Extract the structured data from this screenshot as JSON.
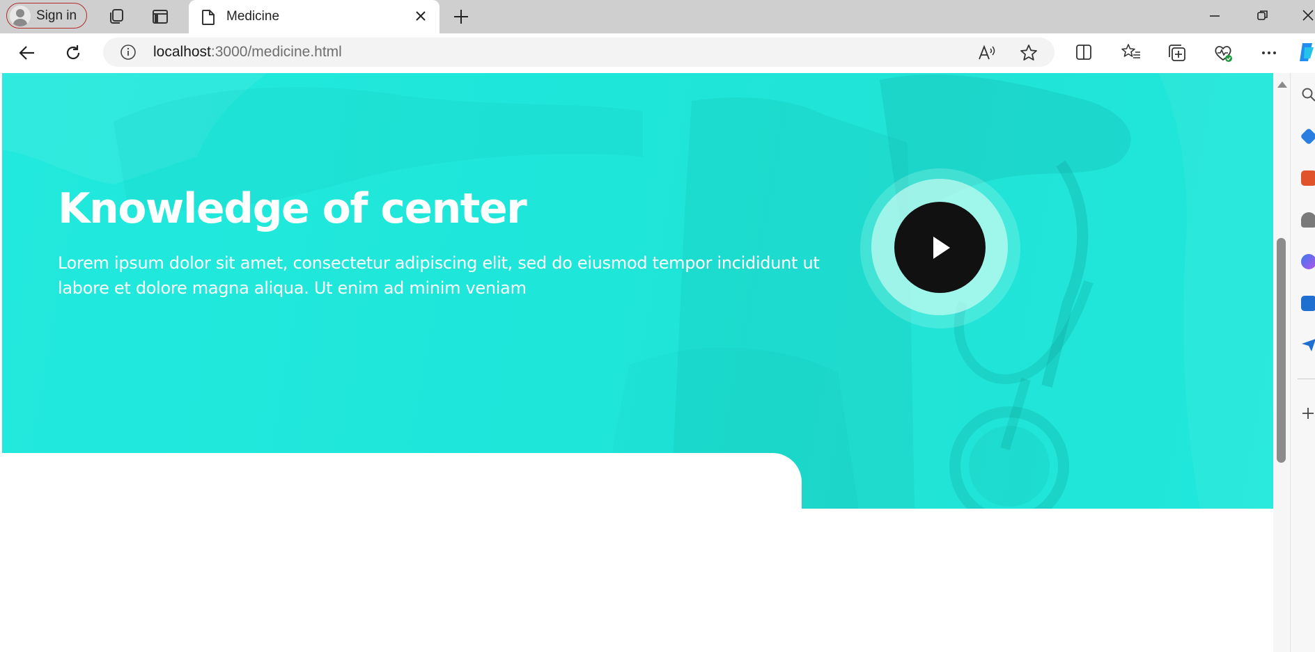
{
  "browser": {
    "signin_label": "Sign in",
    "tab": {
      "title": "Medicine"
    },
    "address": {
      "host": "localhost",
      "path": ":3000/medicine.html"
    }
  },
  "hero": {
    "title": "Knowledge of center",
    "text": "Lorem ipsum dolor sit amet, consectetur adipiscing elit, sed do eiusmod tempor incididunt ut labore et dolore magna aliqua. Ut enim ad minim veniam"
  },
  "colors": {
    "accent": "#1fe6da",
    "play_button": "#111111",
    "tabstrip": "#cfcfcf",
    "signin_border": "#b22a2a"
  },
  "icons": {
    "tabstrip": [
      "workspaces-icon",
      "vertical-tabs-icon",
      "page-icon",
      "close-icon",
      "new-tab-icon"
    ],
    "window": [
      "minimize-icon",
      "restore-icon",
      "close-window-icon"
    ],
    "toolbar": [
      "back-icon",
      "refresh-icon",
      "site-info-icon",
      "read-aloud-icon",
      "favorite-star-icon",
      "split-screen-icon",
      "favorites-icon",
      "collections-icon",
      "browser-essentials-icon",
      "more-icon",
      "copilot-icon"
    ],
    "sidebar": [
      "search-icon",
      "shopping-icon",
      "tools-icon",
      "people-icon",
      "m365-icon",
      "outlook-icon",
      "send-icon",
      "add-icon"
    ]
  }
}
